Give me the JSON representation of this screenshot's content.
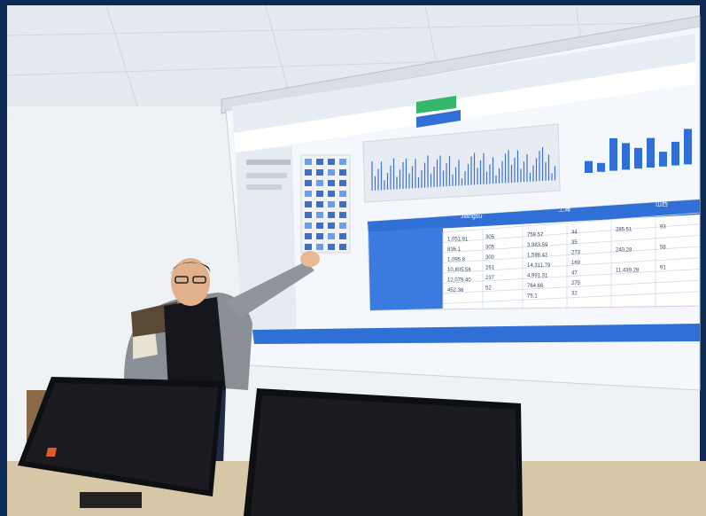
{
  "scene": {
    "description_icons": [
      "projector-screen",
      "presenter",
      "monitor"
    ]
  },
  "screen": {
    "tabs": [
      "",
      "",
      ""
    ],
    "table": {
      "headers": [
        "Jiangsu",
        "上海",
        "山西"
      ],
      "rows": [
        [
          "1,051.91",
          "305",
          "759.57",
          "44",
          "285.51",
          "93"
        ],
        [
          "836.1",
          "305",
          "3,983.59",
          "35",
          "",
          ""
        ],
        [
          "1,095.8",
          "300",
          "1,598.42",
          "273",
          "240.28",
          "58"
        ],
        [
          "10,805.56",
          "261",
          "14,311.79",
          "169",
          "",
          ""
        ],
        [
          "12,079.40",
          "237",
          "4,991.31",
          "47",
          "11,439.28",
          "91"
        ],
        [
          "452.36",
          "52",
          "764.66",
          "275",
          "",
          ""
        ],
        [
          "",
          "",
          "75.1",
          "32",
          "",
          ""
        ]
      ]
    },
    "bar_chart": {
      "values": [
        8,
        6,
        22,
        18,
        14,
        20,
        10,
        16,
        24
      ]
    }
  },
  "colors": {
    "wall": "#e9eef3",
    "screen": "#f4f7fb",
    "accent_blue": "#2f6fd6",
    "border": "#0d2a55"
  }
}
